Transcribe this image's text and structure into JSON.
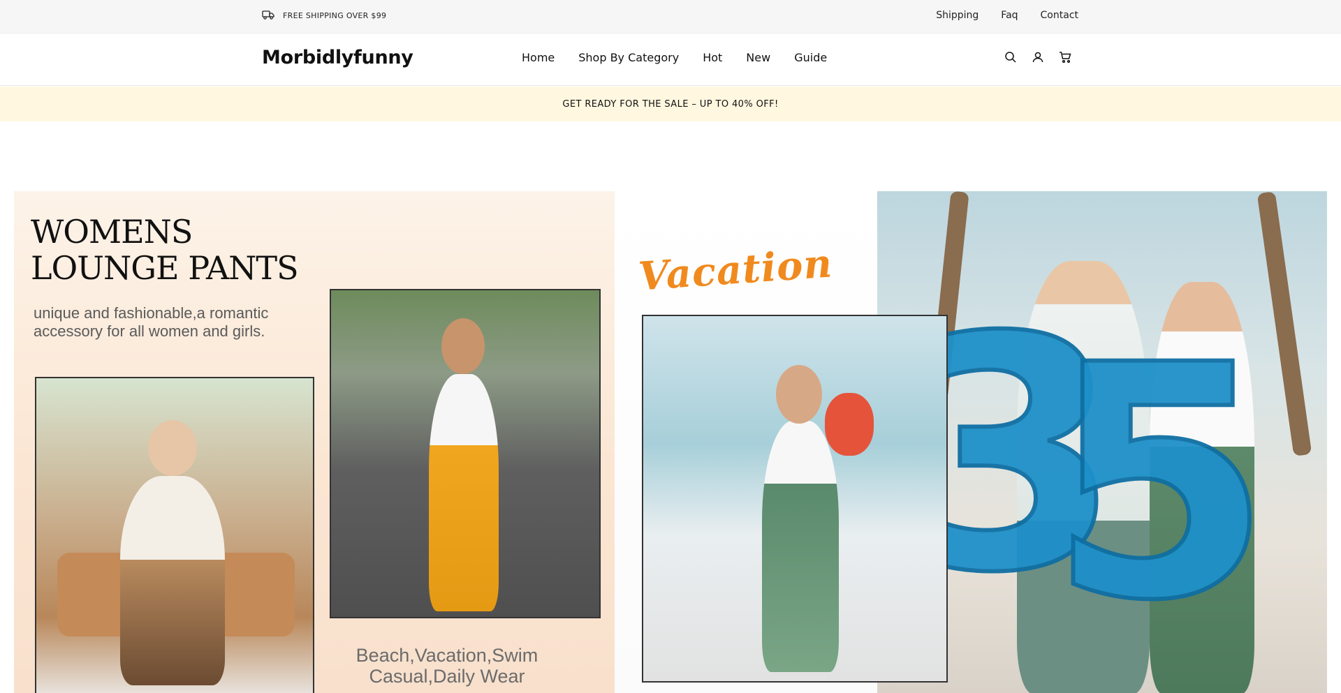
{
  "topbar": {
    "shipping_text": "FREE SHIPPING OVER $99",
    "shipping_icon": "truck-icon",
    "links": [
      "Shipping",
      "Faq",
      "Contact"
    ]
  },
  "header": {
    "logo": "Morbidlyfunny",
    "nav": [
      "Home",
      "Shop By Category",
      "Hot",
      "New",
      "Guide"
    ],
    "icons": [
      "search-icon",
      "account-icon",
      "cart-icon"
    ]
  },
  "announcement": {
    "text": "GET READY FOR THE SALE – UP TO 40% OFF!"
  },
  "hero": {
    "title": "WOMENS\nLOUNGE PANTS",
    "subtitle": "unique and fashionable,a romantic accessory for all women and girls.",
    "bottom_caption": "Beach,Vacation,Swim\nCasual,Daily Wear",
    "script_label": "Vacation",
    "balloon_number": "35"
  },
  "colors": {
    "topbar_bg": "#f6f6f6",
    "announce_bg": "#fff7e0",
    "accent_orange": "#f08a1e",
    "balloon_blue": "#1e90c9"
  }
}
